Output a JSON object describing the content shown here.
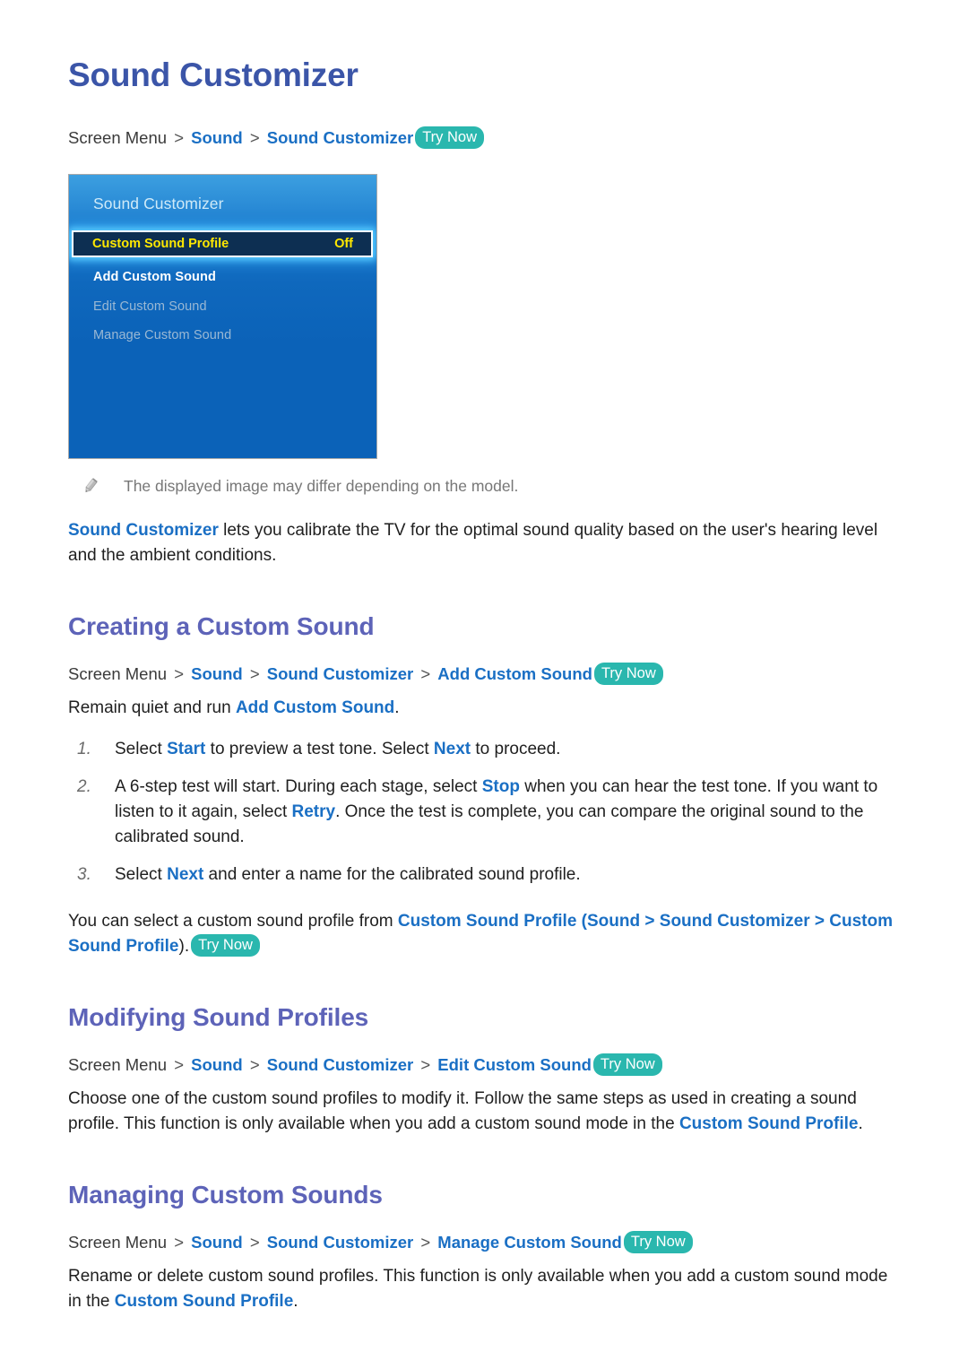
{
  "colors": {
    "h1": "#3b55a8",
    "h2": "#5d63b8",
    "link": "#1a6fc4",
    "try_now_bg": "#2ab7ae",
    "tv_blue": "#0b62b8",
    "tv_selected_bg": "#0d2f52",
    "tv_selected_text": "#ffe800",
    "tv_disabled_text": "#9ab8d4"
  },
  "doc": {
    "title": "Sound Customizer"
  },
  "path_top": {
    "root": "Screen Menu",
    "sep": ">",
    "crumb1": "Sound",
    "crumb2": "Sound Customizer",
    "try_now": "Try Now"
  },
  "tv": {
    "title": "Sound Customizer",
    "selected_row": {
      "label": "Custom Sound Profile",
      "value": "Off"
    },
    "rows": [
      {
        "label": "Add Custom Sound",
        "state": "enabled"
      },
      {
        "label": "Edit Custom Sound",
        "state": "disabled"
      },
      {
        "label": "Manage Custom Sound",
        "state": "disabled"
      }
    ]
  },
  "note": {
    "icon": "pencil-icon",
    "text": "The displayed image may differ depending on the model."
  },
  "intro": {
    "kw": "Sound Customizer",
    "rest": " lets you calibrate the TV for the optimal sound quality based on the user's hearing level and the ambient conditions."
  },
  "section_creating": {
    "heading": "Creating a Custom Sound",
    "path": {
      "root": "Screen Menu",
      "sep": ">",
      "crumb1": "Sound",
      "crumb2": "Sound Customizer",
      "crumb3": "Add Custom Sound",
      "try_now": "Try Now"
    },
    "lead_pre": "Remain quiet and run ",
    "lead_kw": "Add Custom Sound",
    "lead_post": ".",
    "steps": [
      {
        "num": "1.",
        "p1": "Select ",
        "k1": "Start",
        "p2": " to preview a test tone. Select ",
        "k2": "Next",
        "p3": " to proceed."
      },
      {
        "num": "2.",
        "p1": "A 6-step test will start. During each stage, select ",
        "k1": "Stop",
        "p2": " when you can hear the test tone. If you want to listen to it again, select ",
        "k2": "Retry",
        "p3": ". Once the test is complete, you can compare the original sound to the calibrated sound."
      },
      {
        "num": "3.",
        "p1": "Select ",
        "k1": "Next",
        "p2": " and enter a name for the calibrated sound profile.",
        "k2": "",
        "p3": ""
      }
    ],
    "after_pre": "You can select a custom sound profile from ",
    "after_k1": "Custom Sound Profile",
    "after_paren_open": " (",
    "after_k2": "Sound",
    "after_sep1": " > ",
    "after_k3": "Sound Customizer",
    "after_sep2": " > ",
    "after_k4": "Custom Sound Profile",
    "after_paren_close": ").",
    "after_try_now": "Try Now"
  },
  "section_modifying": {
    "heading": "Modifying Sound Profiles",
    "path": {
      "root": "Screen Menu",
      "sep": ">",
      "crumb1": "Sound",
      "crumb2": "Sound Customizer",
      "crumb3": "Edit Custom Sound",
      "try_now": "Try Now"
    },
    "body_pre": "Choose one of the custom sound profiles to modify it. Follow the same steps as used in creating a sound profile. This function is only available when you add a custom sound mode in the ",
    "body_kw": "Custom Sound Profile",
    "body_post": "."
  },
  "section_managing": {
    "heading": "Managing Custom Sounds",
    "path": {
      "root": "Screen Menu",
      "sep": ">",
      "crumb1": "Sound",
      "crumb2": "Sound Customizer",
      "crumb3": "Manage Custom Sound",
      "try_now": "Try Now"
    },
    "body_pre": "Rename or delete custom sound profiles. This function is only available when you add a custom sound mode in the ",
    "body_kw": "Custom Sound Profile",
    "body_post": "."
  }
}
